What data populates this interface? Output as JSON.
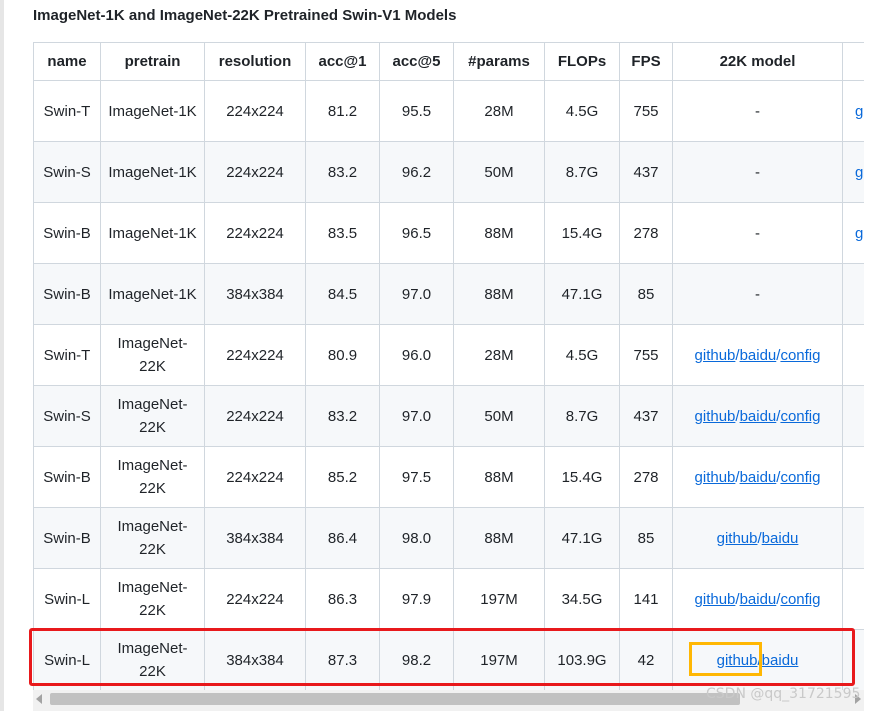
{
  "title": "ImageNet-1K and ImageNet-22K Pretrained Swin-V1 Models",
  "columns": [
    "name",
    "pretrain",
    "resolution",
    "acc@1",
    "acc@5",
    "#params",
    "FLOPs",
    "FPS",
    "22K model"
  ],
  "clipped_link_text": "g",
  "rows": [
    {
      "name": "Swin-T",
      "pretrain": "ImageNet-1K",
      "resolution": "224x224",
      "acc1": "81.2",
      "acc5": "95.5",
      "params": "28M",
      "flops": "4.5G",
      "fps": "755",
      "model22k": "-",
      "extra": "g"
    },
    {
      "name": "Swin-S",
      "pretrain": "ImageNet-1K",
      "resolution": "224x224",
      "acc1": "83.2",
      "acc5": "96.2",
      "params": "50M",
      "flops": "8.7G",
      "fps": "437",
      "model22k": "-",
      "extra": "g"
    },
    {
      "name": "Swin-B",
      "pretrain": "ImageNet-1K",
      "resolution": "224x224",
      "acc1": "83.5",
      "acc5": "96.5",
      "params": "88M",
      "flops": "15.4G",
      "fps": "278",
      "model22k": "-",
      "extra": "g"
    },
    {
      "name": "Swin-B",
      "pretrain": "ImageNet-1K",
      "resolution": "384x384",
      "acc1": "84.5",
      "acc5": "97.0",
      "params": "88M",
      "flops": "47.1G",
      "fps": "85",
      "model22k": "-",
      "extra": ""
    },
    {
      "name": "Swin-T",
      "pretrain": "ImageNet-22K",
      "resolution": "224x224",
      "acc1": "80.9",
      "acc5": "96.0",
      "params": "28M",
      "flops": "4.5G",
      "fps": "755",
      "links": [
        "github",
        "baidu",
        "config"
      ],
      "extra": ""
    },
    {
      "name": "Swin-S",
      "pretrain": "ImageNet-22K",
      "resolution": "224x224",
      "acc1": "83.2",
      "acc5": "97.0",
      "params": "50M",
      "flops": "8.7G",
      "fps": "437",
      "links": [
        "github",
        "baidu",
        "config"
      ],
      "extra": ""
    },
    {
      "name": "Swin-B",
      "pretrain": "ImageNet-22K",
      "resolution": "224x224",
      "acc1": "85.2",
      "acc5": "97.5",
      "params": "88M",
      "flops": "15.4G",
      "fps": "278",
      "links": [
        "github",
        "baidu",
        "config"
      ],
      "extra": ""
    },
    {
      "name": "Swin-B",
      "pretrain": "ImageNet-22K",
      "resolution": "384x384",
      "acc1": "86.4",
      "acc5": "98.0",
      "params": "88M",
      "flops": "47.1G",
      "fps": "85",
      "links": [
        "github",
        "baidu"
      ],
      "extra": ""
    },
    {
      "name": "Swin-L",
      "pretrain": "ImageNet-22K",
      "resolution": "224x224",
      "acc1": "86.3",
      "acc5": "97.9",
      "params": "197M",
      "flops": "34.5G",
      "fps": "141",
      "links": [
        "github",
        "baidu",
        "config"
      ],
      "extra": ""
    },
    {
      "name": "Swin-L",
      "pretrain": "ImageNet-22K",
      "resolution": "384x384",
      "acc1": "87.3",
      "acc5": "98.2",
      "params": "197M",
      "flops": "103.9G",
      "fps": "42",
      "links": [
        "github",
        "baidu"
      ],
      "extra": ""
    }
  ],
  "link_separator": "/",
  "highlight": {
    "row_color": "#e8191c",
    "link_color": "#ffb703"
  },
  "watermark": "CSDN @qq_31721595"
}
